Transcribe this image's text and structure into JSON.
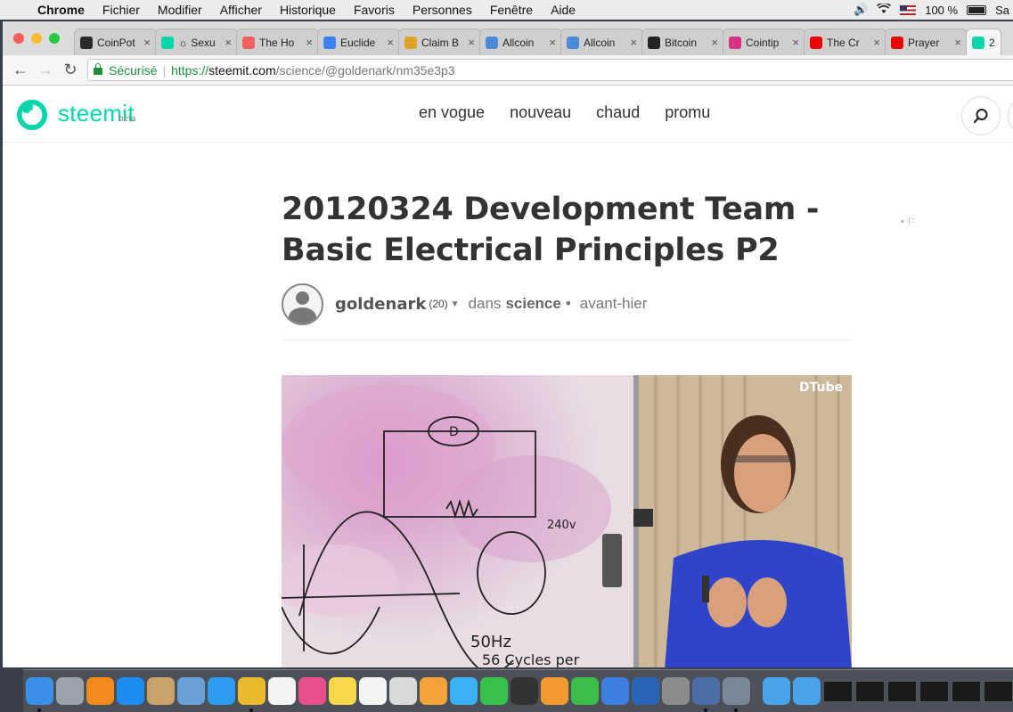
{
  "menubar": {
    "app": "Chrome",
    "items": [
      "Fichier",
      "Modifier",
      "Afficher",
      "Historique",
      "Favoris",
      "Personnes",
      "Fenêtre",
      "Aide"
    ],
    "battery_text": "100 %",
    "user": "Sa"
  },
  "tabs": [
    {
      "label": "CoinPot",
      "color": "#2a2a2a"
    },
    {
      "label": "☼ Sexu",
      "color": "#06d6a9"
    },
    {
      "label": "The Ho",
      "color": "#f06262"
    },
    {
      "label": "Euclide",
      "color": "#3b82f6"
    },
    {
      "label": "Claim B",
      "color": "#e0a528"
    },
    {
      "label": "Allcoin",
      "color": "#4a8bd6"
    },
    {
      "label": "Allcoin",
      "color": "#4a8bd6"
    },
    {
      "label": "Bitcoin",
      "color": "#222"
    },
    {
      "label": "Cointip",
      "color": "#d63384"
    },
    {
      "label": "The Cr",
      "color": "#e00"
    },
    {
      "label": "Prayer",
      "color": "#e00"
    },
    {
      "label": "2",
      "color": "#06d6a9"
    }
  ],
  "toolbar": {
    "secure_label": "Sécurisé",
    "url_scheme": "https://",
    "url_host": "steemit.com",
    "url_path": "/science/@goldenark/nm35e3p3"
  },
  "site": {
    "logo_text": "steemit",
    "beta": "beta",
    "nav": [
      "en vogue",
      "nouveau",
      "chaud",
      "promu"
    ]
  },
  "post": {
    "title": "20120324 Development Team - Basic Electrical Principles P2",
    "author": "goldenark",
    "reputation": "(20)",
    "in_label": "dans",
    "category": "science",
    "time": "avant-hier",
    "video_brand": "DTube"
  },
  "colors": {
    "accent": "#06d6a9",
    "secure": "#1e8e3e"
  },
  "dock": {
    "icons": [
      {
        "name": "finder-icon",
        "color": "#3b8fe8",
        "run": true
      },
      {
        "name": "launchpad-icon",
        "color": "#9aa3ad",
        "run": false
      },
      {
        "name": "ibooks-icon",
        "color": "#f28b1c",
        "run": false
      },
      {
        "name": "app-store-icon",
        "color": "#1d8cf0",
        "run": false
      },
      {
        "name": "contacts-icon",
        "color": "#c9a26b",
        "run": false
      },
      {
        "name": "preview-icon",
        "color": "#6aa0d8",
        "run": false
      },
      {
        "name": "safari-icon",
        "color": "#2d9cf0",
        "run": false
      },
      {
        "name": "chrome-icon",
        "color": "#e9ba2c",
        "run": true
      },
      {
        "name": "calendar-icon",
        "color": "#f4f4f4",
        "run": false
      },
      {
        "name": "itunes-icon",
        "color": "#e94f8b",
        "run": false
      },
      {
        "name": "notes-icon",
        "color": "#f7d84a",
        "run": false
      },
      {
        "name": "reminders-icon",
        "color": "#f4f4f4",
        "run": false
      },
      {
        "name": "textedit-icon",
        "color": "#dadada",
        "run": false
      },
      {
        "name": "photos-icon",
        "color": "#f2a33a",
        "run": false
      },
      {
        "name": "messages-icon",
        "color": "#3bb0f5",
        "run": false
      },
      {
        "name": "facetime-icon",
        "color": "#37c34b",
        "run": false
      },
      {
        "name": "camera-icon",
        "color": "#333",
        "run": false
      },
      {
        "name": "pages-icon",
        "color": "#f29a2e",
        "run": false
      },
      {
        "name": "numbers-icon",
        "color": "#3bbf4a",
        "run": false
      },
      {
        "name": "keynote-icon",
        "color": "#3c7fe0",
        "run": false
      },
      {
        "name": "quicktime-icon",
        "color": "#2a64b6",
        "run": false
      },
      {
        "name": "system-preferences-icon",
        "color": "#8c8c8c",
        "run": false
      },
      {
        "name": "quicktime-player-icon",
        "color": "#4b6ea8",
        "run": true
      },
      {
        "name": "image-capture-icon",
        "color": "#7a8797",
        "run": true
      }
    ],
    "folders": [
      {
        "name": "applications-folder-icon",
        "color": "#4aa3e8"
      },
      {
        "name": "downloads-folder-icon",
        "color": "#4aa3e8"
      }
    ],
    "windows": 6
  }
}
